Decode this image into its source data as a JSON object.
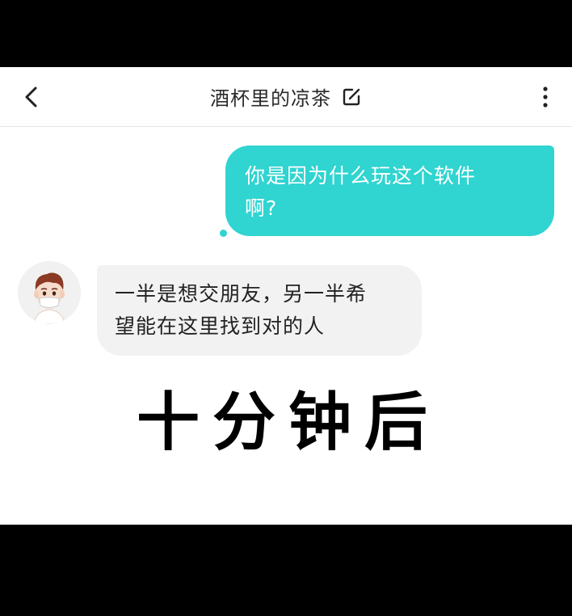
{
  "header": {
    "title": "酒杯里的凉茶",
    "back_icon": "chevron-left-icon",
    "edit_icon": "edit-icon",
    "more_icon": "more-vertical-icon"
  },
  "messages": [
    {
      "direction": "outgoing",
      "text": "你是因为什么玩这个软件啊?",
      "line1": "你是因为什么玩这个软件",
      "line2": "啊?"
    },
    {
      "direction": "incoming",
      "text": "一半是想交朋友，另一半希望能在这里找到对的人",
      "line1": "一半是想交朋友，另一半希",
      "line2": "望能在这里找到对的人"
    }
  ],
  "overlay_caption": "十分钟后",
  "colors": {
    "outgoing_bubble": "#30d4d0",
    "incoming_bubble": "#f2f2f2",
    "background": "#ffffff",
    "letterbox": "#000000"
  }
}
